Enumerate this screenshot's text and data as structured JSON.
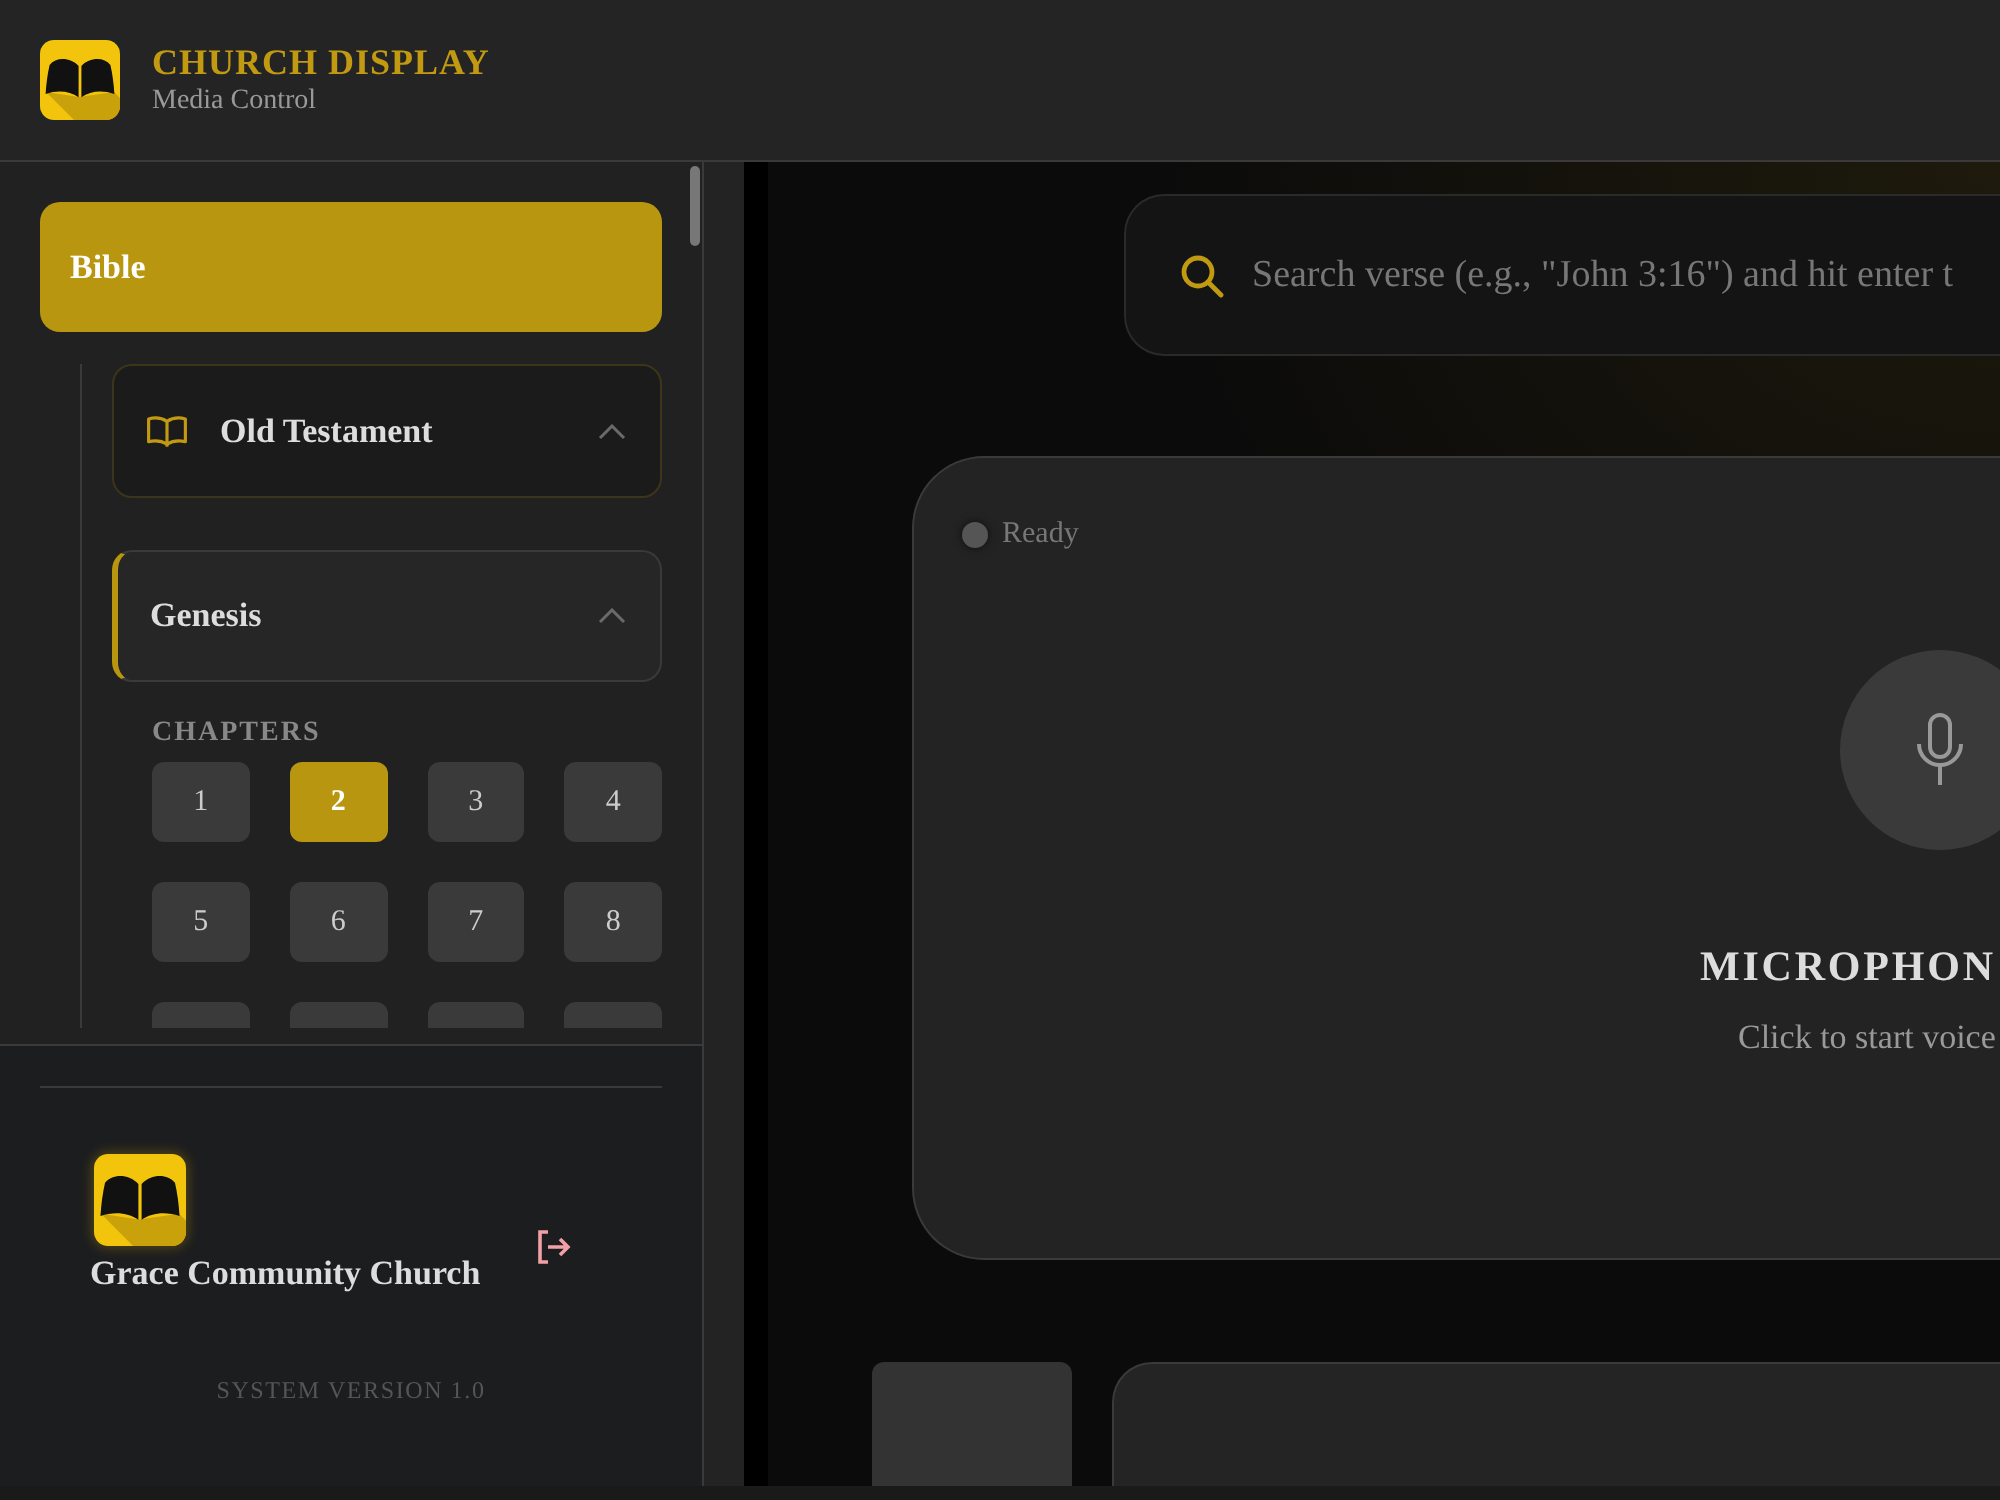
{
  "header": {
    "title": "CHURCH DISPLAY",
    "subtitle": "Media Control"
  },
  "sidebar": {
    "nav": [
      {
        "label": "Bible",
        "selected": true
      }
    ],
    "tree": [
      {
        "label": "Old Testament",
        "expanded": true,
        "children": [
          {
            "label": "Genesis",
            "expanded": true,
            "selected": true,
            "chapters_label": "CHAPTERS",
            "chapters": [
              {
                "label": "1",
                "selected": false
              },
              {
                "label": "2",
                "selected": true
              },
              {
                "label": "3",
                "selected": false
              },
              {
                "label": "4",
                "selected": false
              },
              {
                "label": "5",
                "selected": false
              },
              {
                "label": "6",
                "selected": false
              },
              {
                "label": "7",
                "selected": false
              },
              {
                "label": "8",
                "selected": false
              },
              {
                "selected": false
              },
              {
                "selected": false
              },
              {
                "selected": false
              },
              {
                "selected": false
              }
            ]
          }
        ]
      }
    ],
    "footer": {
      "church_name": "Grace Community Church",
      "version": "SYSTEM VERSION 1.0"
    }
  },
  "search": {
    "placeholder": "Search verse (e.g., \"John 3:16\") and hit enter t"
  },
  "voice": {
    "status": "Ready",
    "listening": false,
    "title": "MICROPHON",
    "hint": "Click to start voice"
  }
}
